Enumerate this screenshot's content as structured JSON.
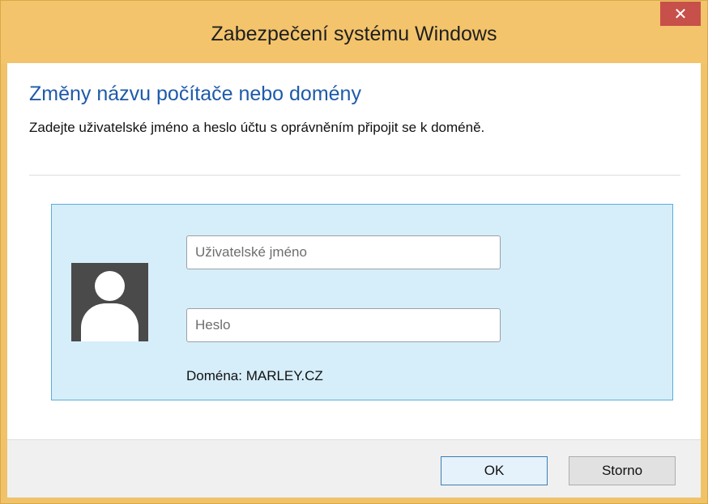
{
  "window": {
    "title": "Zabezpečení systému Windows",
    "close_glyph": "✕"
  },
  "content": {
    "heading": "Změny názvu počítače nebo domény",
    "instruction": "Zadejte uživatelské jméno a heslo účtu s oprávněním připojit se k doméně."
  },
  "credentials": {
    "username_placeholder": "Uživatelské jméno",
    "password_placeholder": "Heslo",
    "domain_label": "Doména: MARLEY.CZ",
    "avatar_icon": "user-avatar-icon"
  },
  "buttons": {
    "ok_label": "OK",
    "cancel_label": "Storno"
  },
  "colors": {
    "titlebar": "#f3c46b",
    "close_button": "#c7504a",
    "heading": "#1e5aa9",
    "credential_panel": "#d6eef9",
    "credential_border": "#5aaedc"
  }
}
